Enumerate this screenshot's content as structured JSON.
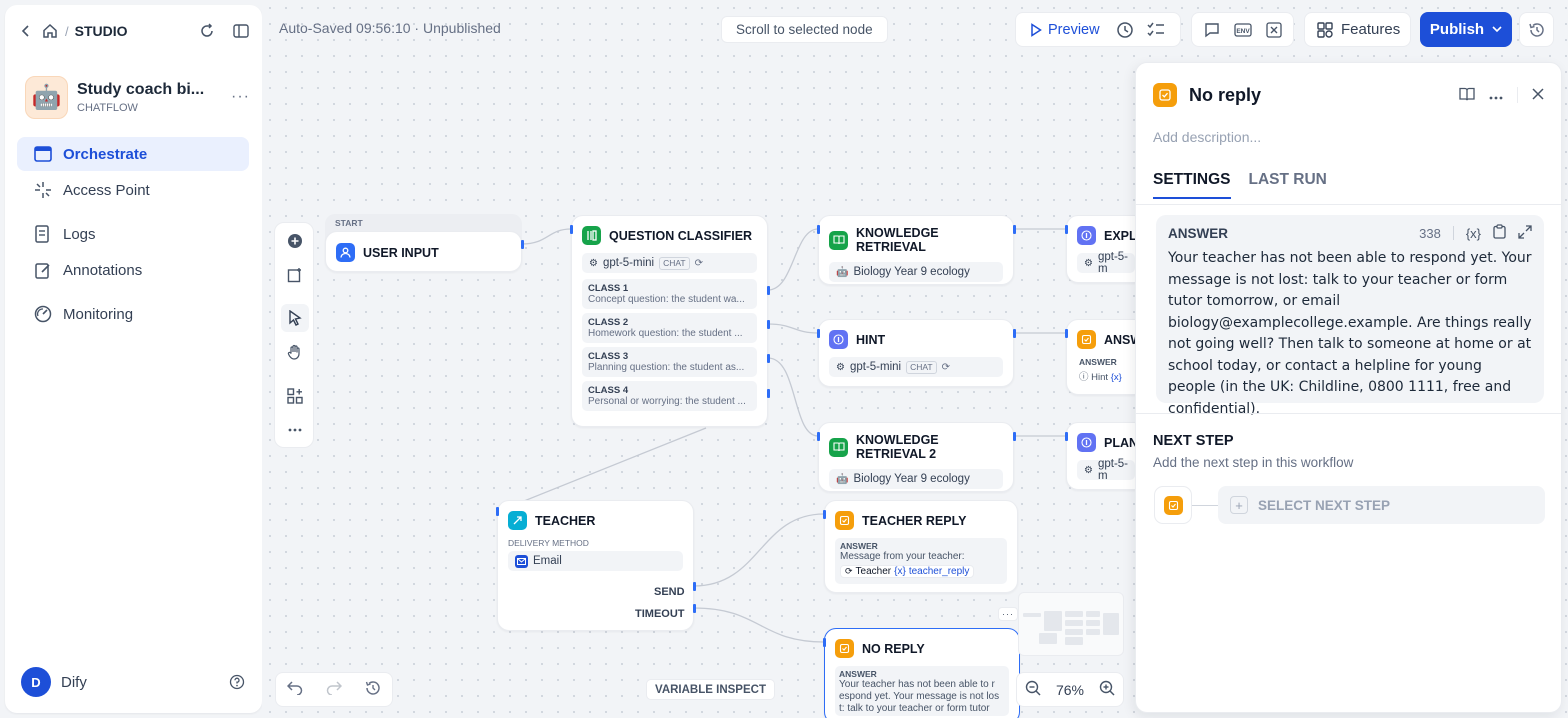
{
  "sidebar": {
    "breadcrumb": "STUDIO",
    "app": {
      "name": "Study coach bi...",
      "type": "CHATFLOW",
      "avatar": "🤖"
    },
    "nav": [
      {
        "label": "Orchestrate",
        "icon": "orchestrate-icon"
      },
      {
        "label": "Access Point",
        "icon": "access-point-icon"
      },
      {
        "label": "Logs",
        "icon": "logs-icon"
      },
      {
        "label": "Annotations",
        "icon": "annotations-icon"
      },
      {
        "label": "Monitoring",
        "icon": "monitoring-icon"
      }
    ],
    "user": {
      "initial": "D",
      "name": "Dify"
    }
  },
  "topbar": {
    "autosave": "Auto-Saved 09:56:10 · Unpublished",
    "scroll_to_node": "Scroll to selected node",
    "preview": "Preview",
    "features": "Features",
    "publish": "Publish"
  },
  "nodes": {
    "start": {
      "tag": "START",
      "title": "USER INPUT"
    },
    "classifier": {
      "title": "QUESTION CLASSIFIER",
      "model": "gpt-5-mini",
      "model_chip": "CHAT",
      "classes": [
        {
          "name": "CLASS 1",
          "desc": "Concept question: the student wa..."
        },
        {
          "name": "CLASS 2",
          "desc": "Homework question: the student ..."
        },
        {
          "name": "CLASS 3",
          "desc": "Planning question: the student as..."
        },
        {
          "name": "CLASS 4",
          "desc": "Personal or worrying: the student ..."
        }
      ]
    },
    "kr1": {
      "title": "KNOWLEDGE RETRIEVAL",
      "dataset": "Biology Year 9 ecology"
    },
    "hint": {
      "title": "HINT",
      "model": "gpt-5-mini",
      "model_chip": "CHAT"
    },
    "kr2": {
      "title": "KNOWLEDGE RETRIEVAL 2",
      "dataset": "Biology Year 9 ecology"
    },
    "expla": {
      "title": "EXPLA",
      "model": "gpt-5-m"
    },
    "answ": {
      "title": "ANSW",
      "label": "ANSWER",
      "var": "Hint",
      "var_suffix": "{x}"
    },
    "plann": {
      "title": "PLANN",
      "model": "gpt-5-m"
    },
    "teacher": {
      "title": "TEACHER",
      "method_label": "DELIVERY METHOD",
      "method": "Email",
      "port_send": "SEND",
      "port_timeout": "TIMEOUT"
    },
    "teacher_reply": {
      "title": "TEACHER REPLY",
      "label": "ANSWER",
      "text": "Message from your teacher:",
      "var_node": "Teacher",
      "var_name": "teacher_reply",
      "var_prefix": "{x}"
    },
    "no_reply": {
      "title": "NO REPLY",
      "label": "ANSWER",
      "text_lines": [
        "Your teacher has not been able to r",
        "espond yet. Your message is not los",
        "t: talk to your teacher or form tutor"
      ]
    }
  },
  "bottom": {
    "variable_inspect": "VARIABLE INSPECT",
    "zoom": "76%"
  },
  "panel": {
    "title": "No reply",
    "description_placeholder": "Add description...",
    "tabs": [
      "SETTINGS",
      "LAST RUN"
    ],
    "answer": {
      "label": "ANSWER",
      "count": "338",
      "var_button": "{x}",
      "text": "Your teacher has not been able to respond yet. Your message is not lost: talk to your teacher or form tutor tomorrow, or email biology@examplecollege.example. Are things really not going well? Then talk to someone at home or at school today, or contact a helpline for young people (in the UK: Childline, 0800 1111, free and confidential)."
    },
    "next_step": {
      "title": "NEXT STEP",
      "subtitle": "Add the next step in this workflow",
      "select": "SELECT NEXT STEP"
    }
  },
  "colors": {
    "accent": "#1d4fd8",
    "answer_node": "#f59e0b",
    "knowledge_node": "#16a34a",
    "llm_node": "#6172f3"
  }
}
